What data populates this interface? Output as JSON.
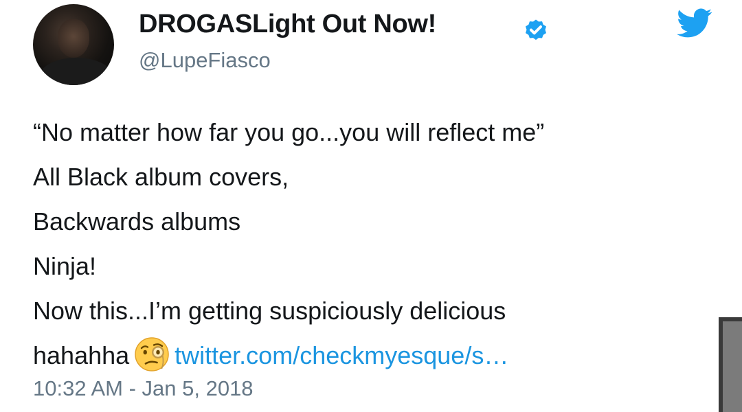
{
  "tweet": {
    "display_name": "DROGASLight Out Now!",
    "handle": "@LupeFiasco",
    "verified": true,
    "lines": [
      "“No matter how far you go...you will reflect me”",
      "All Black album covers,",
      "Backwards albums",
      "Ninja!",
      "Now this...I’m getting suspiciously delicious"
    ],
    "last_line_text": "hahahha",
    "emoji": "face-with-monocle-icon",
    "link": "twitter.com/checkmyesque/s…",
    "timestamp": "10:32 AM - Jan 5, 2018"
  },
  "colors": {
    "twitter_blue": "#1da1f2",
    "link_blue": "#1b95e0",
    "text": "#14171a",
    "secondary_text": "#657786"
  },
  "icons": {
    "brand": "twitter-bird-icon",
    "verified": "verified-badge-icon"
  }
}
